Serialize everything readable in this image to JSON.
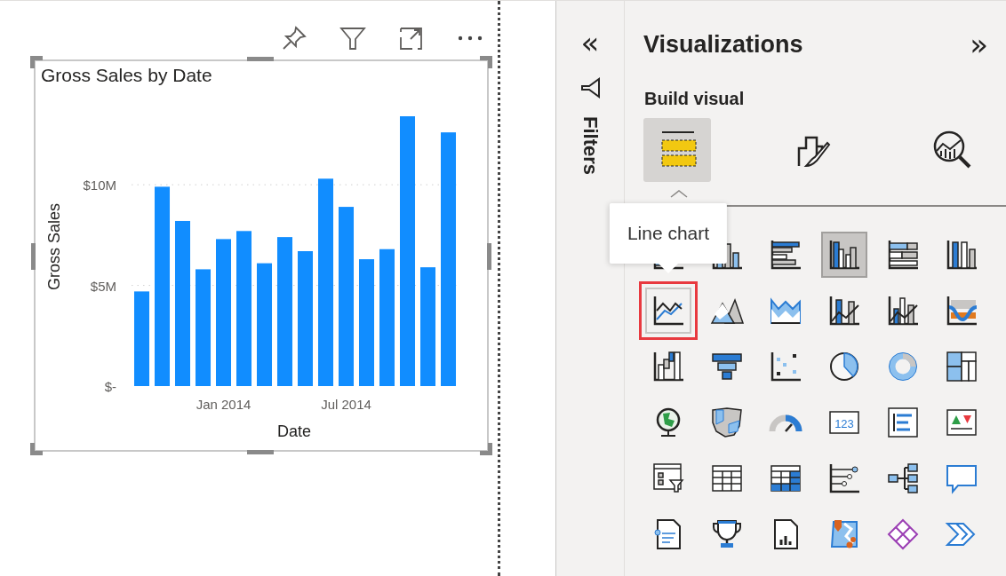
{
  "visual": {
    "chart_data": {
      "type": "bar",
      "title": "Gross Sales by Date",
      "xlabel": "Date",
      "ylabel": "Gross Sales",
      "categories": [
        null,
        null,
        null,
        null,
        "Jan 2014",
        null,
        null,
        null,
        null,
        null,
        "Jul 2014",
        null,
        null,
        null,
        null,
        null
      ],
      "series": [
        {
          "color": "#118dff",
          "values": [
            4700000,
            9900000,
            8200000,
            5800000,
            7300000,
            7700000,
            6100000,
            7400000,
            6700000,
            10300000,
            8900000,
            6300000,
            6800000,
            13400000,
            5900000,
            12600000
          ]
        }
      ],
      "ylim": [
        0,
        13400000
      ],
      "yticks": [
        {
          "value": 0,
          "label": "$-"
        },
        {
          "value": 5000000,
          "label": "$5M"
        },
        {
          "value": 10000000,
          "label": "$10M"
        }
      ]
    }
  },
  "filters_pane": {
    "toggle": "«",
    "title": "Filters"
  },
  "visualizations_pane": {
    "title": "Visualizations",
    "toggle": "»",
    "section": "Build visual",
    "tabs": [
      {
        "kind": "fields",
        "selected": true
      },
      {
        "kind": "format",
        "selected": false
      },
      {
        "kind": "analytics",
        "selected": false
      }
    ],
    "visuals": [
      {
        "kind": "stacked-bar"
      },
      {
        "kind": "stacked-column",
        "selected": false,
        "highlighted": false
      },
      {
        "kind": "clustered-bar",
        "selected": false,
        "highlighted": false
      },
      {
        "kind": "clustered-column",
        "selected": true,
        "highlighted": false
      },
      {
        "kind": "stacked-bar-100",
        "selected": false,
        "highlighted": false
      },
      {
        "kind": "stacked-column-100",
        "selected": false,
        "highlighted": false
      },
      {
        "kind": "line",
        "selected": false,
        "highlighted": true,
        "tooltip": "Line chart"
      },
      {
        "kind": "area",
        "selected": false,
        "highlighted": false
      },
      {
        "kind": "stacked-area",
        "selected": false,
        "highlighted": false
      },
      {
        "kind": "line-stacked-column",
        "selected": false,
        "highlighted": false
      },
      {
        "kind": "line-clustered-column",
        "selected": false,
        "highlighted": false
      },
      {
        "kind": "ribbon",
        "selected": false,
        "highlighted": false
      },
      {
        "kind": "waterfall",
        "selected": false,
        "highlighted": false
      },
      {
        "kind": "funnel",
        "selected": false,
        "highlighted": false
      },
      {
        "kind": "scatter",
        "selected": false,
        "highlighted": false
      },
      {
        "kind": "pie",
        "selected": false,
        "highlighted": false
      },
      {
        "kind": "donut",
        "selected": false,
        "highlighted": false
      },
      {
        "kind": "treemap",
        "selected": false,
        "highlighted": false
      },
      {
        "kind": "map",
        "selected": false,
        "highlighted": false
      },
      {
        "kind": "filled-map",
        "selected": false,
        "highlighted": false
      },
      {
        "kind": "gauge",
        "selected": false,
        "highlighted": false
      },
      {
        "kind": "card",
        "selected": false,
        "highlighted": false,
        "text": "123"
      },
      {
        "kind": "multi-row-card",
        "selected": false,
        "highlighted": false
      },
      {
        "kind": "kpi",
        "selected": false,
        "highlighted": false
      },
      {
        "kind": "slicer",
        "selected": false,
        "highlighted": false
      },
      {
        "kind": "table",
        "selected": false,
        "highlighted": false
      },
      {
        "kind": "matrix",
        "selected": false,
        "highlighted": false
      },
      {
        "kind": "key-influencers",
        "selected": false,
        "highlighted": false
      },
      {
        "kind": "decomposition-tree",
        "selected": false,
        "highlighted": false
      },
      {
        "kind": "qa",
        "selected": false,
        "highlighted": false
      },
      {
        "kind": "smart-narrative",
        "selected": false,
        "highlighted": false
      },
      {
        "kind": "goals",
        "selected": false,
        "highlighted": false
      },
      {
        "kind": "paginated-report",
        "selected": false,
        "highlighted": false
      },
      {
        "kind": "azure-map",
        "selected": false,
        "highlighted": false
      },
      {
        "kind": "power-apps",
        "selected": false,
        "highlighted": false
      },
      {
        "kind": "power-automate",
        "selected": false,
        "highlighted": false
      }
    ]
  }
}
